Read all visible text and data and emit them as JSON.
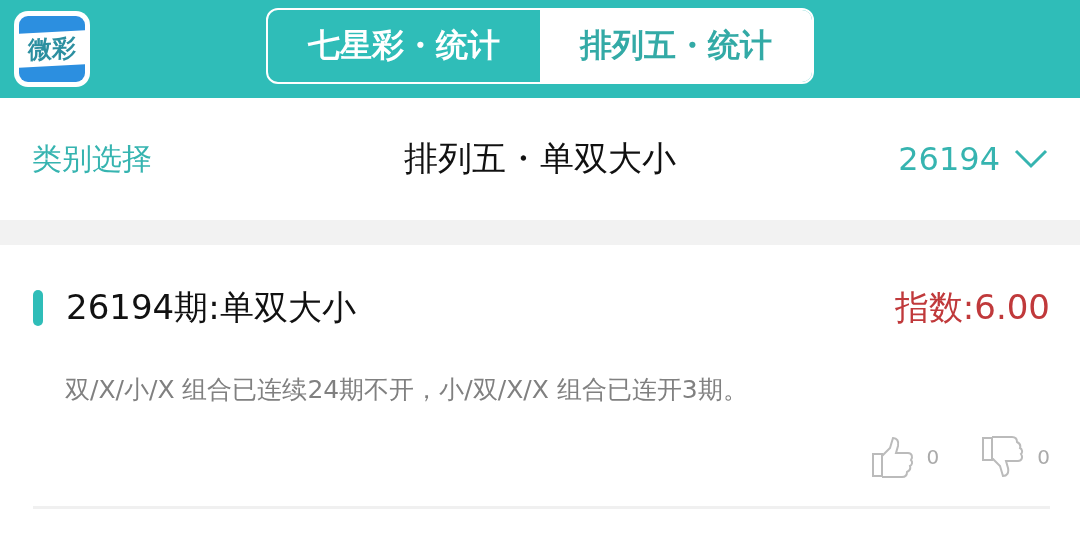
{
  "app_logo": {
    "text": "微彩"
  },
  "tabs": [
    {
      "label": "七星彩・统计",
      "selected": false
    },
    {
      "label": "排列五・统计",
      "selected": true
    }
  ],
  "toolbar": {
    "category_link": "类别选择",
    "title": "排列五・单双大小",
    "period_select": "26194"
  },
  "cards": [
    {
      "title": "26194期:单双大小",
      "index": "指数:6.00",
      "description": "双/X/小/X 组合已连续24期不开，小/双/X/X 组合已连开3期。",
      "likes": "0",
      "dislikes": "0"
    }
  ]
}
